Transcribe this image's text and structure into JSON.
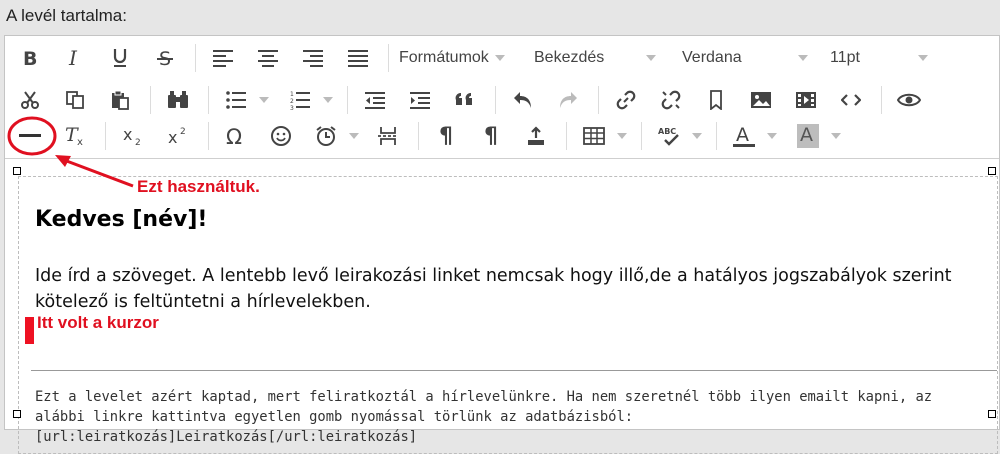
{
  "section_label": "A levél tartalma:",
  "toolbar": {
    "formats_dropdown": "Formátumok",
    "paragraph_dropdown": "Bekezdés",
    "font_dropdown": "Verdana",
    "size_dropdown": "11pt",
    "align_glyph": "¶",
    "text_color_glyph": "A",
    "bg_color_glyph": "A"
  },
  "content": {
    "greeting": "Kedves [név]!",
    "body": "Ide írd a szöveget. A lentebb levő leirakozási linket nemcsak hogy illő,de a hatályos jogszabályok szerint kötelező is feltüntetni a hírlevelekben.",
    "footer": "Ezt a levelet azért kaptad, mert feliratkoztál a hírlevelünkre. Ha nem szeretnél több ilyen emailt kapni, az alábbi linkre kattintva egyetlen gomb nyomással törlünk az adatbázisból: [url:leiratkozás]Leiratkozás[/url:leiratkozás]"
  },
  "annotations": {
    "used_label": "Ezt használtuk.",
    "cursor_label": "Itt volt a kurzor",
    "color": "#e01020"
  }
}
